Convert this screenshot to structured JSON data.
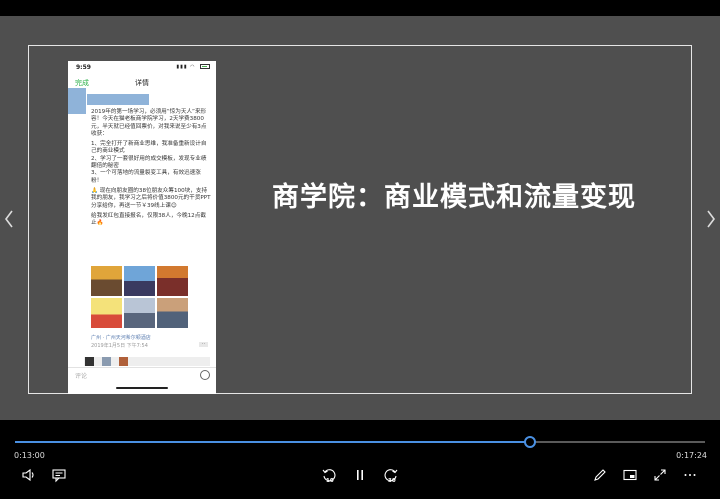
{
  "slide": {
    "title": "商学院：商业模式和流量变现"
  },
  "phone": {
    "status_time": "9:59",
    "nav_done": "完成",
    "nav_title": "详情",
    "post_paragraphs": [
      "2019年的第一场学习，必须用“惊为天人”来形容！今天在猫老板商学院学习，2天学费3800元，半天就已经值回票价，对我来说至少有3点收获：",
      "1、完全打开了新商业思维，我准备重新设计自己的商业模式\n2、学习了一套很好用的成交模板，发现专业绩翻倍的秘密\n3、一个可落地的流量裂变工具，有效迅速涨粉！",
      "🙏 现在向朋友圈的38位朋友众筹100块，支持我的朋友，我学习之后将价值3800元的干货PPT分享给你，再送一节￥39线上课😊",
      "给我发红包直接报名，仅限38人，今晚12点截止🔥"
    ],
    "location": "广州 · 广州天河希尔顿酒店",
    "date": "2019年1月5日 下午7:54",
    "comment_placeholder": "评论"
  },
  "player": {
    "current_time": "0:13:00",
    "total_time": "0:17:24",
    "progress_fraction": 0.7471,
    "skip_back_label": "10",
    "skip_forward_label": "30",
    "accent_color": "#4a90e2"
  }
}
